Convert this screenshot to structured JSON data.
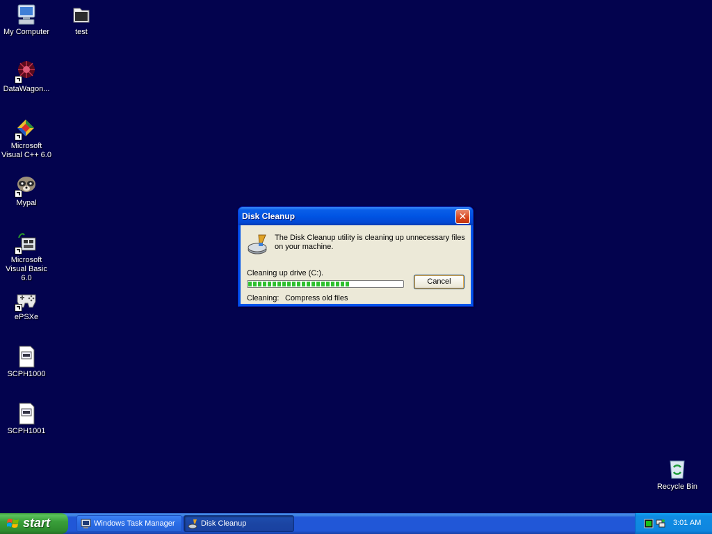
{
  "desktop": {
    "background_color": "#03034e",
    "icons": [
      {
        "label": "My Computer",
        "icon": "computer-icon"
      },
      {
        "label": "test",
        "icon": "folder-icon"
      },
      {
        "label": "DataWagon...",
        "icon": "datawagon-icon"
      },
      {
        "label": "Microsoft Visual C++ 6.0",
        "icon": "visual-cpp-icon"
      },
      {
        "label": "Mypal",
        "icon": "mypal-raccoon-icon"
      },
      {
        "label": "Microsoft Visual Basic 6.0",
        "icon": "visual-basic-icon"
      },
      {
        "label": "ePSXe",
        "icon": "gamepad-icon"
      },
      {
        "label": "SCPH1000",
        "icon": "bin-file-icon"
      },
      {
        "label": "SCPH1001",
        "icon": "bin-file-icon"
      },
      {
        "label": "Recycle Bin",
        "icon": "recycle-bin-icon"
      }
    ]
  },
  "dialog": {
    "title": "Disk Cleanup",
    "close_label": "✕",
    "message": "The Disk Cleanup utility is cleaning up unnecessary files on your machine.",
    "drive_text": "Cleaning up drive  (C:).",
    "progress_fraction": 0.66,
    "cancel_label": "Cancel",
    "status_label": "Cleaning:",
    "status_value": "Compress old files"
  },
  "taskbar": {
    "start_label": "start",
    "tasks": [
      {
        "label": "Windows Task Manager",
        "icon": "task-manager-icon",
        "active": false
      },
      {
        "label": "Disk Cleanup",
        "icon": "disk-cleanup-icon",
        "active": true
      }
    ],
    "tray": {
      "icons": [
        "task-manager-tray-icon",
        "network-tray-icon"
      ],
      "clock": "3:01 AM"
    }
  }
}
